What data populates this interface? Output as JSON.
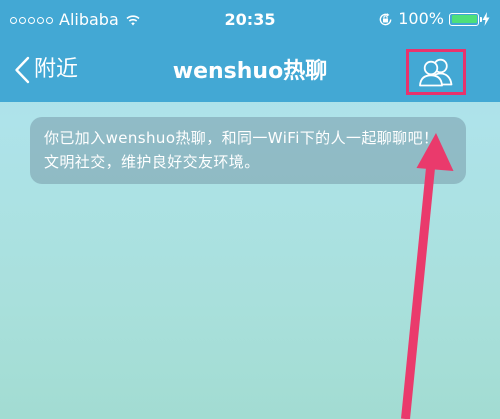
{
  "status_bar": {
    "carrier": "Alibaba",
    "time": "20:35",
    "battery_percent": "100%",
    "battery_level": 1.0,
    "signal_dots": 5,
    "icons": [
      "signal-dots-icon",
      "wifi-icon",
      "orientation-lock-icon",
      "battery-icon",
      "charging-icon"
    ]
  },
  "nav": {
    "back_label": "附近",
    "title": "wenshuo热聊",
    "members_button_icon": "group-members-icon"
  },
  "notice": {
    "text": "你已加入wenshuo热聊，和同一WiFi下的人一起聊聊吧！文明社交，维护良好交友环境。"
  },
  "colors": {
    "nav_background": "#43a8d4",
    "highlight_border": "#e8336d",
    "annotation_arrow": "#ea3a6c",
    "battery_fill": "#4ee07a"
  }
}
